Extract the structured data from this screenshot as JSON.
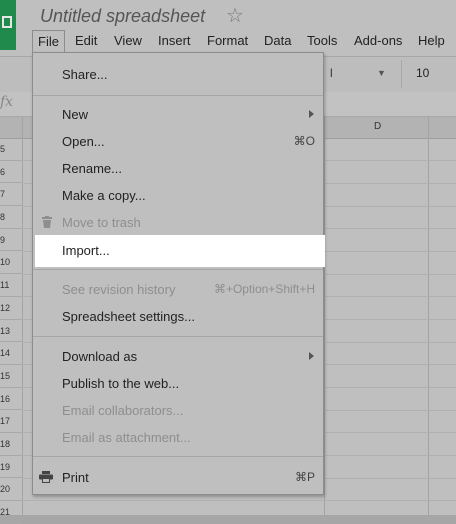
{
  "app": {
    "title": "Untitled spreadsheet",
    "star_glyph": "☆"
  },
  "menubar": {
    "items": [
      "File",
      "Edit",
      "View",
      "Insert",
      "Format",
      "Data",
      "Tools",
      "Add-ons",
      "Help"
    ]
  },
  "toolbar": {
    "font_fragment": "l",
    "font_size": "10"
  },
  "formula_bar": {
    "fx": "fx"
  },
  "grid": {
    "column_label": "D",
    "row_numbers": [
      "5",
      "6",
      "7",
      "8",
      "9",
      "10",
      "11",
      "12",
      "13",
      "14",
      "15",
      "16",
      "17",
      "18",
      "19",
      "20",
      "21"
    ]
  },
  "file_menu": {
    "share": "Share...",
    "new": "New",
    "open": "Open...",
    "open_shortcut": "⌘O",
    "rename": "Rename...",
    "make_copy": "Make a copy...",
    "move_to_trash": "Move to trash",
    "import": "Import...",
    "revision_history": "See revision history",
    "revision_shortcut": "⌘+Option+Shift+H",
    "spreadsheet_settings": "Spreadsheet settings...",
    "download_as": "Download as",
    "publish": "Publish to the web...",
    "email_collaborators": "Email collaborators...",
    "email_attachment": "Email as attachment...",
    "print": "Print",
    "print_shortcut": "⌘P"
  },
  "colors": {
    "logo": "#1f8a4c",
    "highlight": "#ffffff",
    "overlay": "#bfbfbf"
  }
}
